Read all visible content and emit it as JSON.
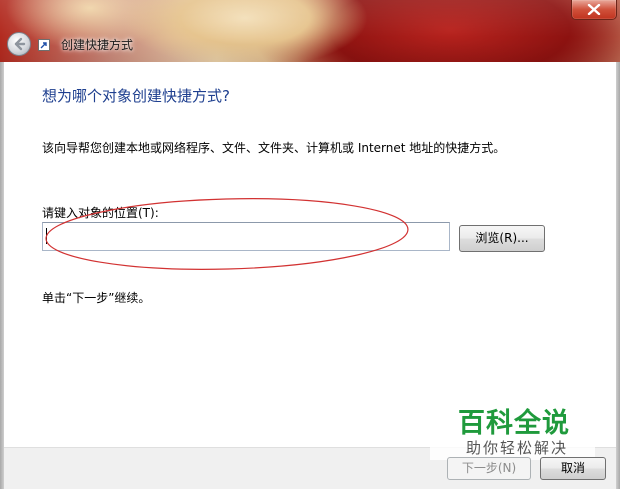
{
  "window": {
    "title": "创建快捷方式",
    "back_icon": "back-arrow-icon",
    "close_icon": "close-icon",
    "wizard_icon": "shortcut-icon"
  },
  "main": {
    "heading": "想为哪个对象创建快捷方式?",
    "description": "该向导帮您创建本地或网络程序、文件、文件夹、计算机或 Internet 地址的快捷方式。",
    "location_label": "请键入对象的位置(T):",
    "location_value": "",
    "browse_label": "浏览(R)...",
    "hint": "单击“下一步”继续。"
  },
  "footer": {
    "next_label": "下一步(N)",
    "cancel_label": "取消"
  },
  "watermark": {
    "main": "百科全说",
    "sub": "助你轻松解决"
  },
  "colors": {
    "heading": "#1e3f8f",
    "annotation": "#d23232",
    "watermark_main": "#1f9a3c"
  }
}
